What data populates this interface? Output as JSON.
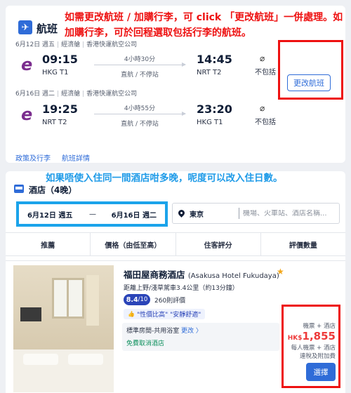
{
  "flight_section": {
    "title": "航班",
    "outbound": {
      "meta": [
        "6月12日 週五",
        "經濟艙",
        "香港快運航空公司"
      ],
      "depart_time": "09:15",
      "depart_code": "HKG T1",
      "duration": "4小時30分",
      "stops": "直航 / 不停站",
      "arrive_time": "14:45",
      "arrive_code": "NRT T2",
      "baggage": "不包括"
    },
    "inbound": {
      "meta": [
        "6月16日 週二",
        "經濟艙",
        "香港快運航空公司"
      ],
      "depart_time": "19:25",
      "depart_code": "NRT T2",
      "duration": "4小時55分",
      "stops": "直航 / 不停站",
      "arrive_time": "23:20",
      "arrive_code": "HKG T1",
      "baggage": "不包括"
    },
    "change_flight_label": "更改航班",
    "links": {
      "policy": "政策及行李",
      "details": "航班詳情"
    }
  },
  "annotations": {
    "red": "如需更改航班 / 加購行李，可 click 「更改航班」一併處理。如加購行李，可於回程選取包括行李的航班。",
    "blue": "如果唔使入住同一間酒店咁多晚，呢度可以改入住日數。"
  },
  "hotel_section": {
    "title": "酒店（4晚）",
    "checkin": "6月12日 週五",
    "checkout": "6月16日 週二",
    "date_separator": "—",
    "destination": "東京",
    "destination_placeholder": "機場、火車站、酒店名稱...",
    "sort_tabs": [
      "推薦",
      "價格（由低至高）",
      "住客評分",
      "評價數量"
    ]
  },
  "listing": {
    "name": "福田屋商務酒店",
    "name_en": "(Asakusa Hotel Fukudaya)",
    "distance": "距離上野/淺草駕車3.4公里（約13分鐘）",
    "score": "8.4",
    "score_total": "/10",
    "reviews": "260則評價",
    "tag": "\"性價比高\" \"安靜舒適\"",
    "room_type": "標準房間-共用浴室",
    "room_change": "更改 〉",
    "cancellation": "免費取消酒店",
    "price_label_top": "機票 + 酒店",
    "price_currency": "HK$",
    "price_amount": "1,855",
    "price_label_bottom_1": "每人機票 + 酒店",
    "price_label_bottom_2": "連稅及附加費",
    "select_label": "選擇"
  },
  "colors": {
    "accent": "#2f6cd8",
    "annotation_red": "#ee1111",
    "annotation_blue": "#1f9be8",
    "price_red": "#ee3a3a",
    "score_bg": "#2a44b8",
    "airline_purple": "#7b2d8e"
  },
  "icons": {
    "flight": "airplane-icon",
    "baggage": "no-baggage-icon",
    "hotel": "bed-icon",
    "destination": "location-pin-icon",
    "favorite": "star-icon"
  }
}
